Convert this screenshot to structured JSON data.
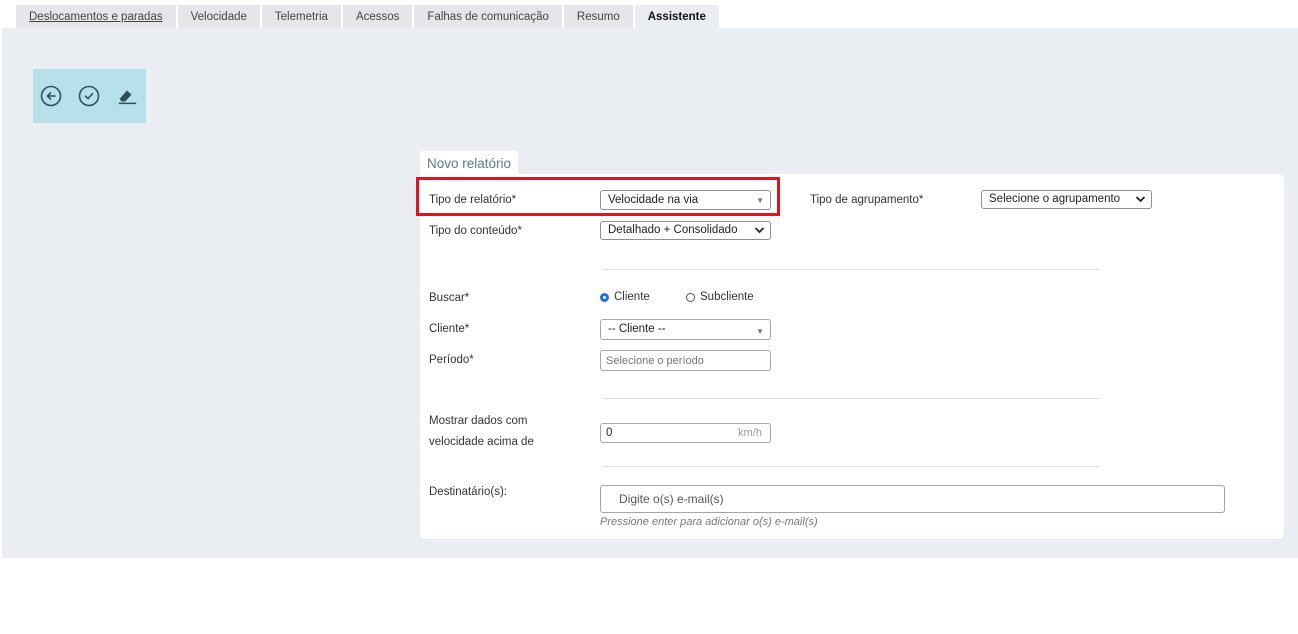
{
  "tabs": [
    {
      "label": "Deslocamentos e paradas"
    },
    {
      "label": "Velocidade"
    },
    {
      "label": "Telemetria"
    },
    {
      "label": "Acessos"
    },
    {
      "label": "Falhas de comunicação"
    },
    {
      "label": "Resumo"
    },
    {
      "label": "Assistente"
    }
  ],
  "active_tab": "Assistente",
  "toolbar": {
    "icons": [
      "back-icon",
      "confirm-icon",
      "eraser-icon"
    ]
  },
  "card": {
    "title": "Novo relatório"
  },
  "form": {
    "tipo_relatorio": {
      "label": "Tipo de relatório*",
      "value": "Velocidade na via"
    },
    "tipo_agrupamento": {
      "label": "Tipo de agrupamento*",
      "value": "Selecione o agrupamento"
    },
    "tipo_conteudo": {
      "label": "Tipo do conteúdo*",
      "value": "Detalhado + Consolidado"
    },
    "buscar": {
      "label": "Buscar*",
      "options": [
        "Cliente",
        "Subcliente"
      ],
      "selected": "Cliente"
    },
    "cliente": {
      "label": "Cliente*",
      "value": "-- Cliente --"
    },
    "periodo": {
      "label": "Período*",
      "placeholder": "Selecione o período"
    },
    "velocidade": {
      "label_line1": "Mostrar dados com",
      "label_line2": "velocidade acima de",
      "value": "0",
      "unit": "km/h"
    },
    "destinatarios": {
      "label": "Destinatário(s):",
      "placeholder": "Digite o(s) e-mail(s)",
      "hint": "Pressione enter para adicionar o(s) e-mail(s)"
    }
  },
  "colors": {
    "toolbar_bg": "#b7e1ea",
    "highlight": "#e0131f",
    "radio_on": "#1a73e8"
  }
}
